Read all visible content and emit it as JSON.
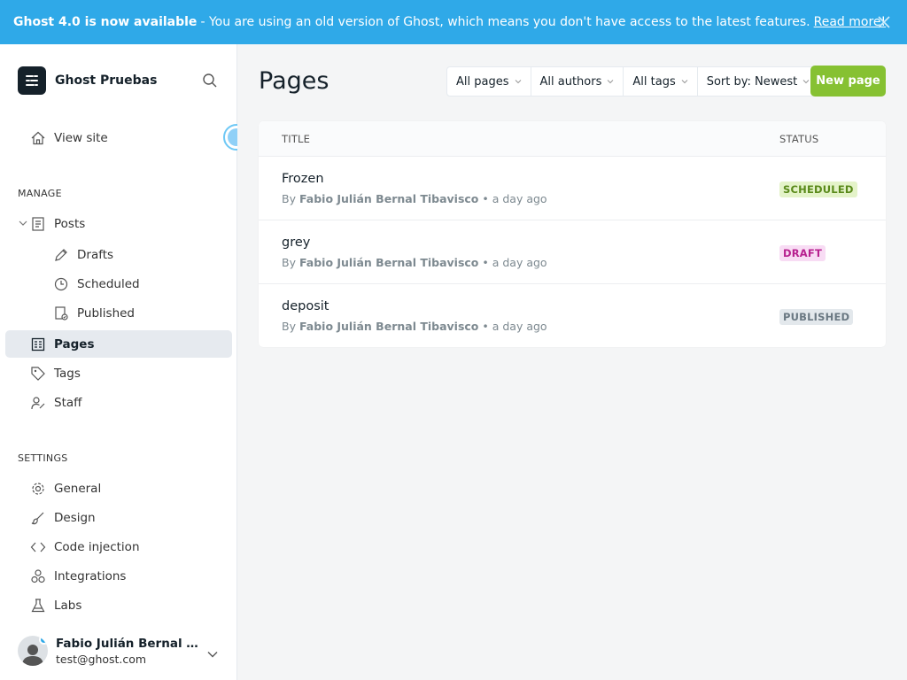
{
  "banner": {
    "bold": "Ghost 4.0 is now available",
    "message": "- You are using an old version of Ghost, which means you don't have access to the latest features.",
    "link": "Read more!"
  },
  "sidebar": {
    "site_name": "Ghost Pruebas",
    "view_site": "View site",
    "manage_label": "MANAGE",
    "posts": "Posts",
    "drafts": "Drafts",
    "scheduled": "Scheduled",
    "published": "Published",
    "pages": "Pages",
    "tags": "Tags",
    "staff": "Staff",
    "settings_label": "SETTINGS",
    "general": "General",
    "design": "Design",
    "code_injection": "Code injection",
    "integrations": "Integrations",
    "labs": "Labs"
  },
  "user": {
    "name": "Fabio Julián Bernal Tibavisco",
    "email": "test@ghost.com"
  },
  "main": {
    "title": "Pages",
    "filters": [
      "All pages",
      "All authors",
      "All tags",
      "Sort by: Newest"
    ],
    "new_button": "New page",
    "columns": {
      "title": "TITLE",
      "status": "STATUS"
    },
    "rows": [
      {
        "title": "Frozen",
        "by": "By",
        "author": "Fabio Julián Bernal Tibavisco",
        "time": "• a day ago",
        "status": "SCHEDULED"
      },
      {
        "title": "grey",
        "by": "By",
        "author": "Fabio Julián Bernal Tibavisco",
        "time": "• a day ago",
        "status": "DRAFT"
      },
      {
        "title": "deposit",
        "by": "By",
        "author": "Fabio Julián Bernal Tibavisco",
        "time": "• a day ago",
        "status": "PUBLISHED"
      }
    ]
  },
  "colors": {
    "banner": "#2fa9e8",
    "accent_green": "#86c132",
    "scheduled_bg": "#e4f3c9",
    "scheduled_fg": "#5a8a1a",
    "draft_bg": "#f8dcf4",
    "draft_fg": "#b7208f",
    "published_bg": "#e3e8ec",
    "published_fg": "#6a7882"
  }
}
